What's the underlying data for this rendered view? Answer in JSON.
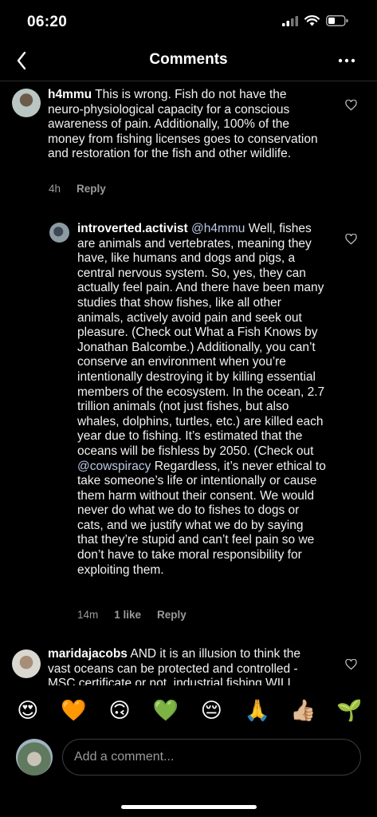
{
  "status": {
    "time": "06:20"
  },
  "header": {
    "title": "Comments"
  },
  "comments": [
    {
      "username": "h4mmu",
      "text": "This is wrong. Fish do not have the neuro-physiological capacity for a conscious awareness of pain. Additionally, 100% of the money from fishing licenses goes to conservation and restoration for the fish and other wildlife.",
      "time": "4h",
      "reply_label": "Reply"
    },
    {
      "username": "introverted.activist",
      "mention": "@h4mmu",
      "text_1": "Well, fishes are animals and vertebrates, meaning they have, like humans and dogs and pigs, a central nervous system. So, yes, they can actually feel pain. And there have been many studies that show fishes, like all other animals, actively avoid pain and seek out pleasure. (Check out What a Fish Knows by Jonathan Balcombe.) Additionally, you can’t conserve an environment when you’re intentionally destroying it by killing essential members of the ecosystem. In the ocean, 2.7 trillion animals (not just fishes, but also whales, dolphins, turtles, etc.) are killed each year due to fishing. It’s estimated that the oceans will be fishless by 2050. (Check out",
      "mention_2": "@cowspiracy",
      "text_2": "Regardless, it’s never ethical to take someone’s life or intentionally or cause them harm without their consent. We would never do what we do to fishes to dogs or cats, and we justify what we do by saying that they’re stupid and can’t feel pain so we don’t have to take moral responsibility for exploiting them.",
      "time": "14m",
      "likes": "1 like",
      "reply_label": "Reply"
    },
    {
      "username": "maridajacobs",
      "text": "AND it is an illusion to think the vast oceans can be protected and controlled - MSC certificate or not, industrial fishing WILL"
    }
  ],
  "emoji_bar": [
    "😍",
    "🧡",
    "🙃",
    "💚",
    "😔",
    "🙏",
    "👍🏼",
    "🌱"
  ],
  "composer": {
    "placeholder": "Add a comment..."
  }
}
